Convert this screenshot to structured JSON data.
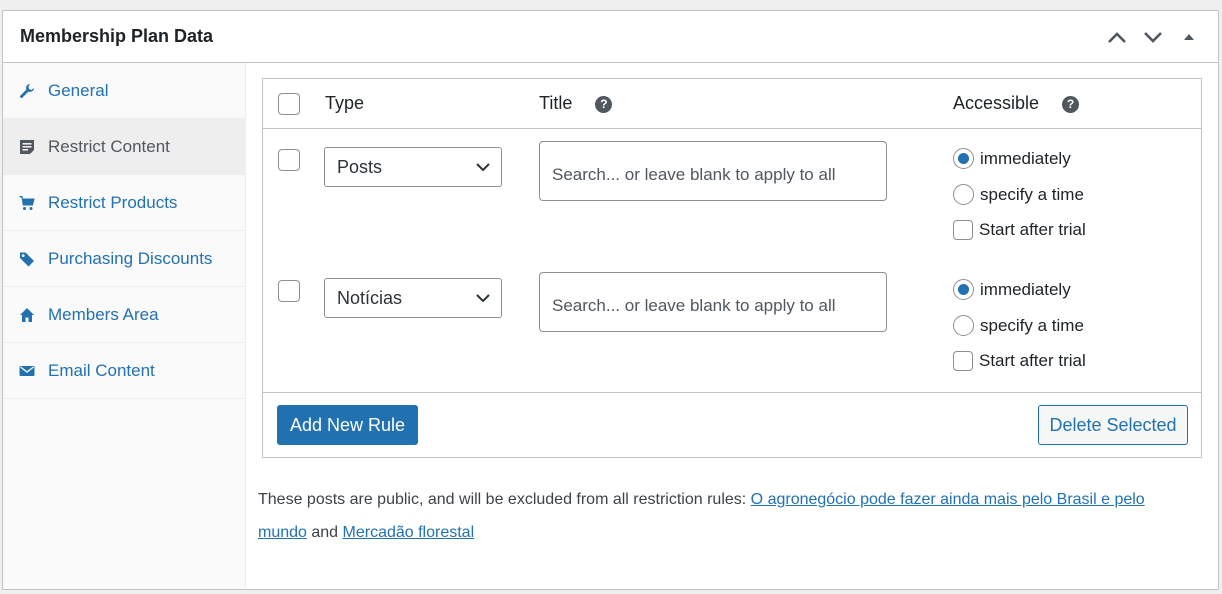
{
  "header": {
    "title": "Membership Plan Data",
    "controls": {
      "up_icon": "chevron-up-icon",
      "down_icon": "chevron-down-icon",
      "toggle_icon": "triangle-up-icon"
    }
  },
  "tabs": [
    {
      "label": "General",
      "icon": "wrench-icon",
      "active": false
    },
    {
      "label": "Restrict Content",
      "icon": "document-icon",
      "active": true
    },
    {
      "label": "Restrict Products",
      "icon": "cart-icon",
      "active": false
    },
    {
      "label": "Purchasing Discounts",
      "icon": "tag-icon",
      "active": false
    },
    {
      "label": "Members Area",
      "icon": "home-icon",
      "active": false
    },
    {
      "label": "Email Content",
      "icon": "email-icon",
      "active": false
    }
  ],
  "rules_table": {
    "columns": {
      "type": "Type",
      "title": "Title",
      "accessible": "Accessible"
    },
    "rows": [
      {
        "type_value": "Posts",
        "title_placeholder": "Search... or leave blank to apply to all",
        "options": {
          "immediately": "immediately",
          "specify": "specify a time",
          "trial": "Start after trial"
        },
        "selected": "immediately"
      },
      {
        "type_value": "Notícias",
        "title_placeholder": "Search... or leave blank to apply to all",
        "options": {
          "immediately": "immediately",
          "specify": "specify a time",
          "trial": "Start after trial"
        },
        "selected": "immediately"
      }
    ],
    "add_button": "Add New Rule",
    "delete_button": "Delete Selected"
  },
  "notice": {
    "text_before": "These posts are public, and will be excluded from all restriction rules: ",
    "link1": "O agronegócio pode fazer ainda mais pelo Brasil e pelo mundo",
    "text_mid": " and ",
    "link2": "Mercadão florestal"
  },
  "colors": {
    "accent": "#2271b1",
    "border": "#c3c4c7",
    "sidebar_bg": "#fafafa",
    "active_tab_bg": "#eeeeee"
  }
}
